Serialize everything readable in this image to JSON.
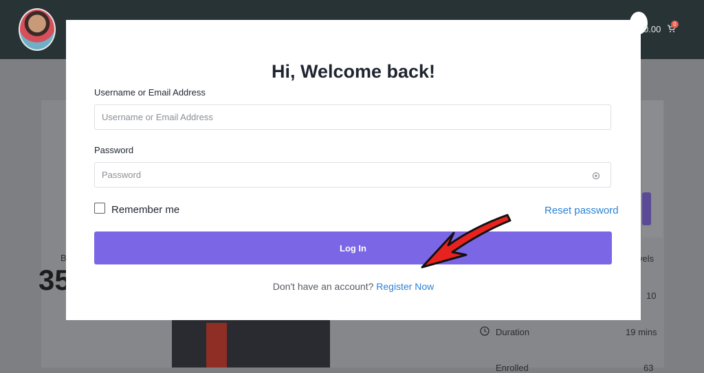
{
  "header": {
    "cart_total": "0.00",
    "cart_count": "0"
  },
  "background": {
    "stat_big": "35",
    "duration_label": "Duration",
    "duration_value": "19 mins",
    "levels_label": "vels",
    "lessons_value": "10",
    "enrolled_label": "Enrolled",
    "enrolled_value": "63",
    "prefix_char": "B"
  },
  "modal": {
    "title": "Hi, Welcome back!",
    "username_label": "Username or Email Address",
    "username_placeholder": "Username or Email Address",
    "password_label": "Password",
    "password_placeholder": "Password",
    "remember_label": "Remember me",
    "reset_link": "Reset password",
    "login_button": "Log In",
    "no_account_text": "Don't have an account?",
    "register_link": "Register Now"
  },
  "colors": {
    "header_bg": "#283336",
    "accent": "#7b66e6",
    "link": "#2b82d4"
  }
}
